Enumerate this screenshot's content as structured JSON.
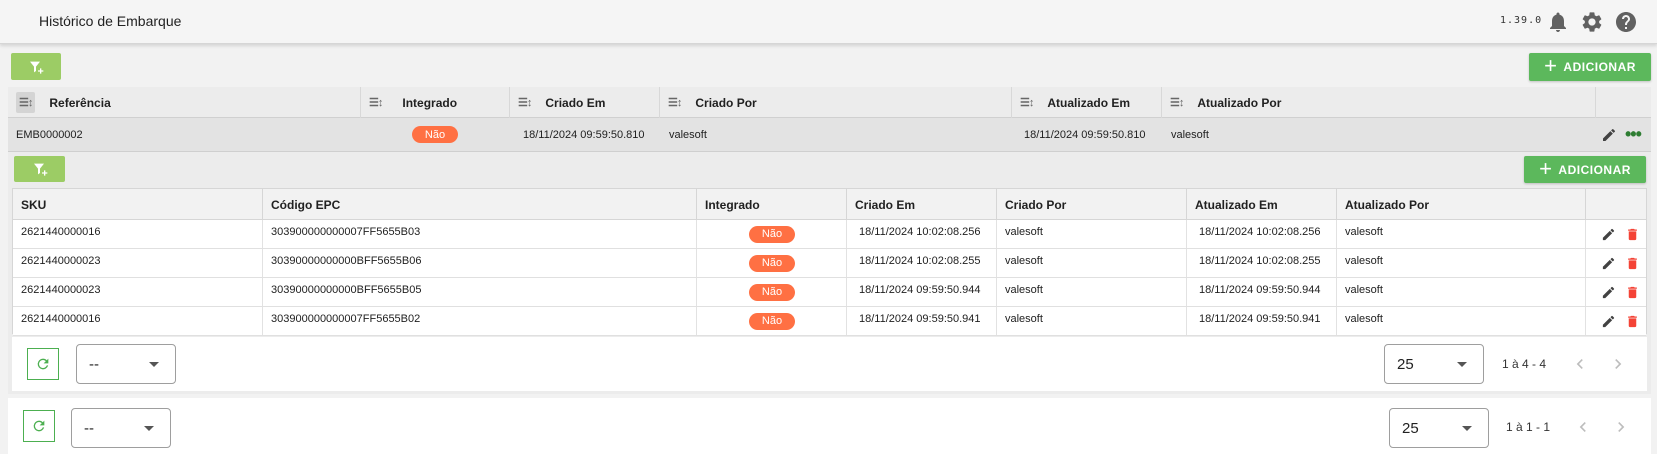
{
  "app": {
    "title": "Histórico de Embarque",
    "version": "1.39.0",
    "icons": [
      "bell-icon",
      "gear-icon",
      "help-icon"
    ]
  },
  "colors": {
    "accent_green": "#5cb85c",
    "filter_green": "#9ccc65",
    "badge_orange": "#ff7043",
    "delete_red": "#f44336"
  },
  "toolbar": {
    "add_label": "ADICIONAR"
  },
  "outer_table": {
    "columns": [
      "Referência",
      "Integrado",
      "Criado Em",
      "Criado Por",
      "Atualizado Em",
      "Atualizado Por"
    ],
    "rows": [
      {
        "referencia": "EMB0000002",
        "integrado": "Não",
        "criado_em": "18/11/2024 09:59:50.810",
        "criado_por": "valesoft",
        "atualizado_em": "18/11/2024 09:59:50.810",
        "atualizado_por": "valesoft"
      }
    ]
  },
  "inner_table": {
    "add_label": "ADICIONAR",
    "columns": [
      "SKU",
      "Código EPC",
      "Integrado",
      "Criado Em",
      "Criado Por",
      "Atualizado Em",
      "Atualizado Por"
    ],
    "rows": [
      {
        "sku": "2621440000016",
        "epc": "303900000000007FF5655B03",
        "integrado": "Não",
        "criado_em": "18/11/2024 10:02:08.256",
        "criado_por": "valesoft",
        "atualizado_em": "18/11/2024 10:02:08.256",
        "atualizado_por": "valesoft"
      },
      {
        "sku": "2621440000023",
        "epc": "30390000000000BFF5655B06",
        "integrado": "Não",
        "criado_em": "18/11/2024 10:02:08.255",
        "criado_por": "valesoft",
        "atualizado_em": "18/11/2024 10:02:08.255",
        "atualizado_por": "valesoft"
      },
      {
        "sku": "2621440000023",
        "epc": "30390000000000BFF5655B05",
        "integrado": "Não",
        "criado_em": "18/11/2024 09:59:50.944",
        "criado_por": "valesoft",
        "atualizado_em": "18/11/2024 09:59:50.944",
        "atualizado_por": "valesoft"
      },
      {
        "sku": "2621440000016",
        "epc": "303900000000007FF5655B02",
        "integrado": "Não",
        "criado_em": "18/11/2024 09:59:50.941",
        "criado_por": "valesoft",
        "atualizado_em": "18/11/2024 09:59:50.941",
        "atualizado_por": "valesoft"
      }
    ],
    "pager": {
      "filter_value": "--",
      "page_size": "25",
      "range": "1 à 4 - 4"
    }
  },
  "outer_pager": {
    "filter_value": "--",
    "page_size": "25",
    "range": "1 à 1 - 1"
  }
}
